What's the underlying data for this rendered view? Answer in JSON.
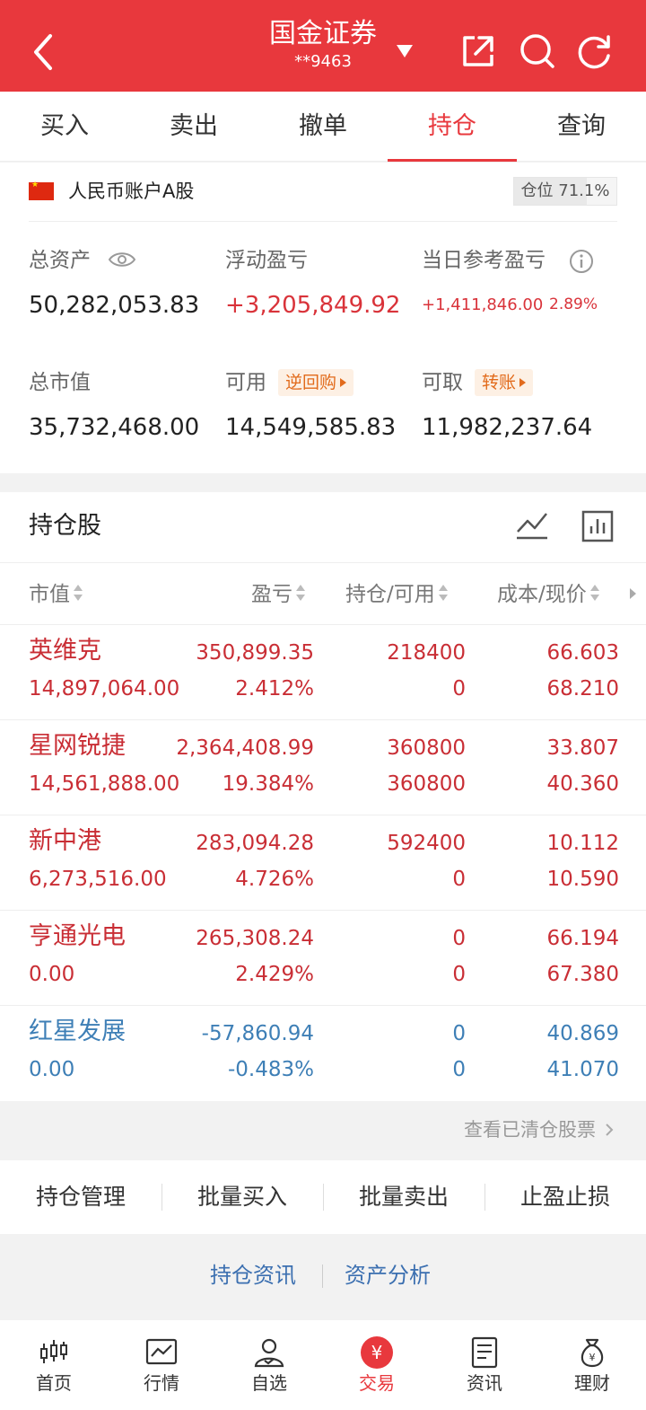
{
  "header": {
    "title": "国金证券",
    "account": "**9463"
  },
  "tabs": [
    {
      "label": "买入"
    },
    {
      "label": "卖出"
    },
    {
      "label": "撤单"
    },
    {
      "label": "持仓"
    },
    {
      "label": "查询"
    }
  ],
  "active_tab": "持仓",
  "account": {
    "type": "人民币账户A股",
    "position_label": "仓位 71.1%",
    "position_ratio": 0.711,
    "total_assets_label": "总资产",
    "total_assets": "50,282,053.83",
    "floating_pl_label": "浮动盈亏",
    "floating_pl": "+3,205,849.92",
    "daily_pl_label": "当日参考盈亏",
    "daily_pl": "+1,411,846.00",
    "daily_pl_pct": "2.89%",
    "market_value_label": "总市值",
    "market_value": "35,732,468.00",
    "available_label": "可用",
    "available": "14,549,585.83",
    "reverse_repo": "逆回购",
    "withdrawable_label": "可取",
    "withdrawable": "11,982,237.64",
    "transfer": "转账"
  },
  "holdings": {
    "title": "持仓股",
    "columns": [
      "市值",
      "盈亏",
      "持仓/可用",
      "成本/现价"
    ],
    "rows": [
      {
        "name": "英维克",
        "market_value": "14,897,064.00",
        "pl": "350,899.35",
        "pl_pct": "2.412%",
        "position": "218400",
        "available": "0",
        "cost": "66.603",
        "price": "68.210",
        "color": "red"
      },
      {
        "name": "星网锐捷",
        "market_value": "14,561,888.00",
        "pl": "2,364,408.99",
        "pl_pct": "19.384%",
        "position": "360800",
        "available": "360800",
        "cost": "33.807",
        "price": "40.360",
        "color": "red"
      },
      {
        "name": "新中港",
        "market_value": "6,273,516.00",
        "pl": "283,094.28",
        "pl_pct": "4.726%",
        "position": "592400",
        "available": "0",
        "cost": "10.112",
        "price": "10.590",
        "color": "red"
      },
      {
        "name": "亨通光电",
        "market_value": "0.00",
        "pl": "265,308.24",
        "pl_pct": "2.429%",
        "position": "0",
        "available": "0",
        "cost": "66.194",
        "price": "67.380",
        "color": "red"
      },
      {
        "name": "红星发展",
        "market_value": "0.00",
        "pl": "-57,860.94",
        "pl_pct": "-0.483%",
        "position": "0",
        "available": "0",
        "cost": "40.869",
        "price": "41.070",
        "color": "blue"
      }
    ]
  },
  "cleared_link": "查看已清仓股票",
  "actions": [
    "持仓管理",
    "批量买入",
    "批量卖出",
    "止盈止损"
  ],
  "links": [
    "持仓资讯",
    "资产分析"
  ],
  "bottom_nav": [
    {
      "label": "首页",
      "icon": "candlestick-icon"
    },
    {
      "label": "行情",
      "icon": "chart-icon"
    },
    {
      "label": "自选",
      "icon": "person-check-icon"
    },
    {
      "label": "交易",
      "icon": "yuan-icon",
      "glyph": "¥"
    },
    {
      "label": "资讯",
      "icon": "document-icon"
    },
    {
      "label": "理财",
      "icon": "money-bag-icon"
    }
  ],
  "colors": {
    "brand_red": "#e8383d",
    "profit_red": "#c92e35",
    "loss_blue": "#3e7fb6",
    "chip_orange": "#e26b1c"
  }
}
